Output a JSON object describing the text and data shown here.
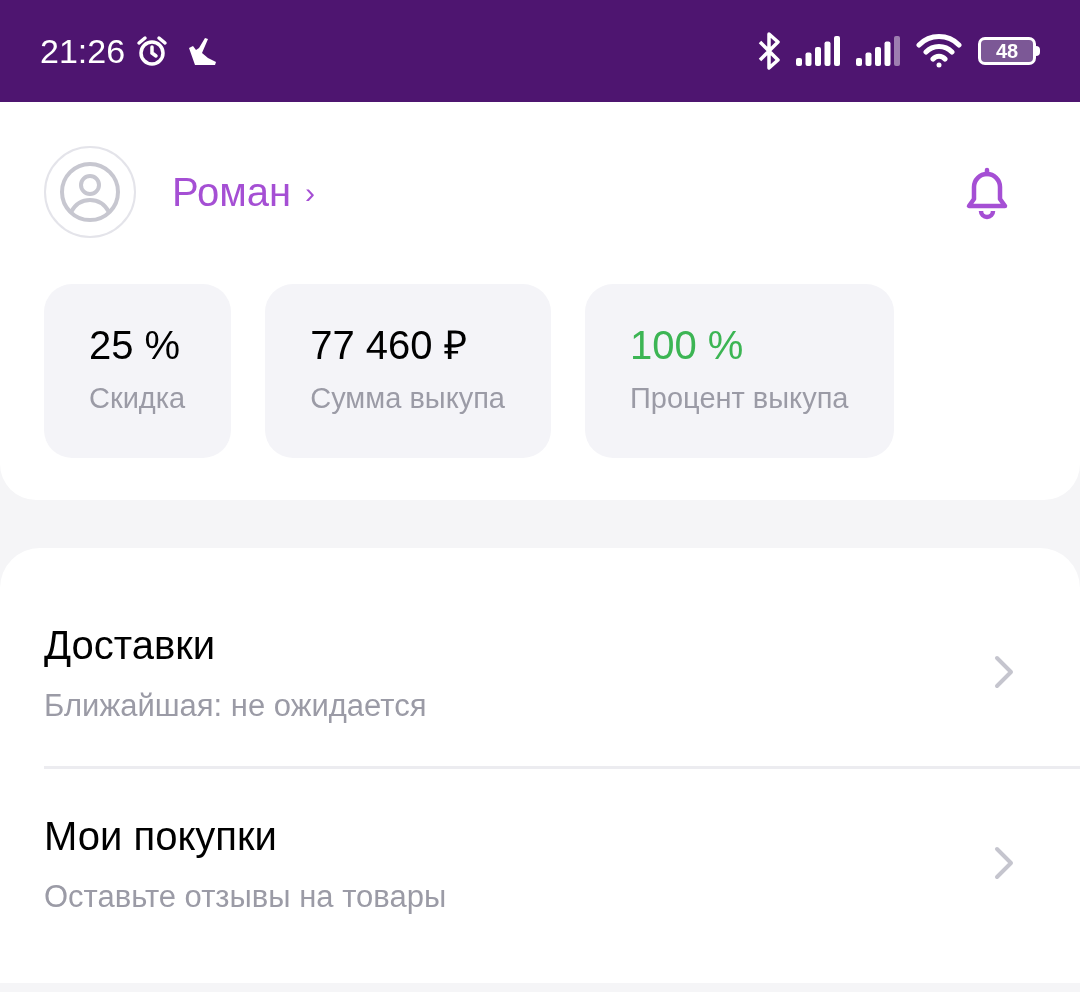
{
  "status_bar": {
    "time": "21:26",
    "battery": "48"
  },
  "profile": {
    "name": "Роман",
    "chevron": "›"
  },
  "stats": [
    {
      "value": "25 %",
      "label": "Скидка",
      "color": "#000000"
    },
    {
      "value": "77 460 ₽",
      "label": "Сумма выкупа",
      "color": "#000000"
    },
    {
      "value": "100 %",
      "label": "Процент выкупа",
      "color": "#3cb554"
    }
  ],
  "menu": [
    {
      "title": "Доставки",
      "subtitle": "Ближайшая: не ожидается"
    },
    {
      "title": "Мои покупки",
      "subtitle": "Оставьте отзывы на товары"
    }
  ]
}
